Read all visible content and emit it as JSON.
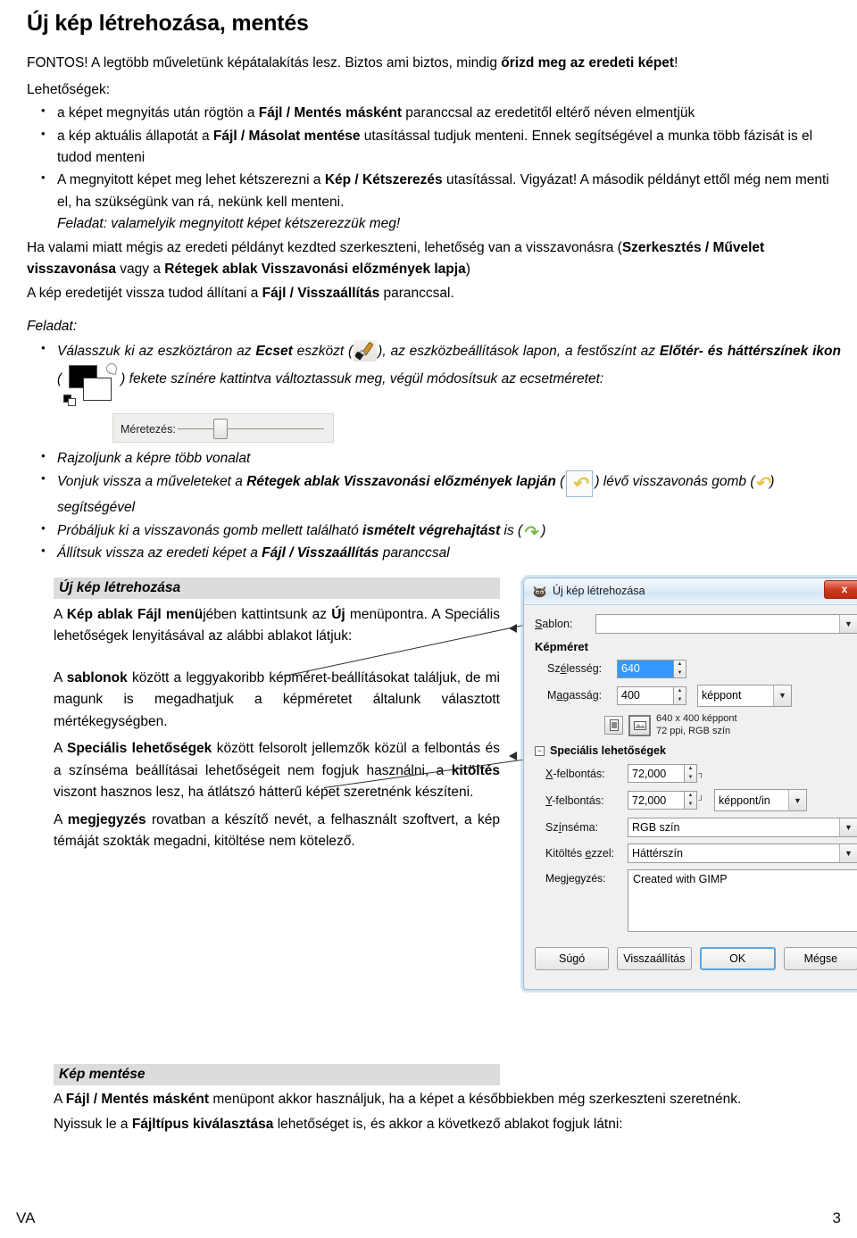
{
  "document": {
    "title": "Új kép létrehozása, mentés",
    "intro_prefix": "FONTOS! A legtöbb műveletünk képátalakítás lesz. Biztos ami biztos, mindig ",
    "intro_bold": "őrizd meg az eredeti képet",
    "intro_suffix": "!",
    "lehetosegek_label": "Lehetőségek:"
  },
  "options_bullets": [
    {
      "pre": "a képet megnyitás után rögtön a ",
      "bold": "Fájl / Mentés másként",
      "post": " paranccsal az eredetitől eltérő néven elmentjük"
    },
    {
      "pre": "a kép aktuális állapotát a ",
      "bold": "Fájl / Másolat mentése",
      "post": " utasítással tudjuk menteni. Ennek segítségével a munka több fázisát is el tudod menteni"
    },
    {
      "pre": "A megnyitott képet meg lehet kétszerezni a ",
      "bold": "Kép / Kétszerezés",
      "post": " utasítással. Vigyázat! A második példányt ettől még nem menti el, ha szükségünk van rá, nekünk kell menteni.",
      "task": "Feladat: valamelyik megnyitott képet kétszerezzük meg!"
    }
  ],
  "undo_paragraph": {
    "p1_pre": "Ha valami miatt mégis az eredeti példányt kezdted szerkeszteni, lehetőség van a visszavonásra (",
    "p1_bold1": "Szerkesztés / Művelet visszavonása",
    "p1_mid": " vagy a ",
    "p1_bold2": "Rétegek ablak Visszavonási előzmények lapja",
    "p1_post": ")",
    "p2_pre": "A kép eredetijét vissza tudod állítani a ",
    "p2_bold": "Fájl / Visszaállítás",
    "p2_post": " paranccsal."
  },
  "feladat_label": "Feladat:",
  "task_bullets": {
    "brush": {
      "pre": "Válasszuk ki az eszköztáron az ",
      "bold1": "Ecset",
      "mid1": " eszközt (",
      "icon1": "brush-icon",
      "mid2": "), az eszközbeállítások lapon, a festőszínt az ",
      "bold2": "Előtér- és háttérszínek ikon",
      "mid3": " (",
      "icon2": "foreground-background-color-icon",
      "post": ") fekete színére kattintva változtassuk meg, végül módosítsuk az ecsetméretet:"
    },
    "size_widget_label": "Méretezés:",
    "draw": "Rajzoljunk a képre több vonalat",
    "undo": {
      "pre": "Vonjuk vissza a műveleteket a ",
      "bold": "Rétegek ablak Visszavonási előzmények lapján",
      "mid1": " (",
      "icon1": "undo-history-tab-icon",
      "mid2": ") lévő visszavonás gomb (",
      "icon2": "undo-arrow-icon",
      "post": ") segítségével"
    },
    "redo": {
      "pre": "Próbáljuk ki a visszavonás gomb mellett található ",
      "bold": "ismételt végrehajtást",
      "mid": " is (",
      "icon": "redo-arrow-icon",
      "post": " )"
    },
    "revert": {
      "pre": "Állítsuk vissza az eredeti képet a ",
      "bold": "Fájl / Visszaállítás",
      "post": " paranccsal"
    }
  },
  "section_new_image": {
    "heading": "Új kép létrehozása",
    "p1_pre": "A ",
    "p1_bold": "Kép ablak Fájl menü",
    "p1_post": "jében kattintsunk az ",
    "p1_bold2": "Új",
    "p1_post2": " menüpontra. A Speciális lehetőségek lenyitásával az alábbi ablakot látjuk:",
    "p2_pre": "A ",
    "p2_bold": "sablonok",
    "p2_post": " között a leggyakoribb képméret-beállításokat találjuk, de mi magunk is megadhatjuk a képméretet általunk választott mértékegységben.",
    "p3_pre": "A ",
    "p3_bold": "Speciális lehetőségek",
    "p3_mid": " között felsorolt jellemzők közül a felbontás és a színséma beállításai lehetőségeit nem fogjuk használni, a ",
    "p3_bold2": "kitöltés",
    "p3_post": " viszont hasznos lesz, ha átlátszó hátterű képet szeretnénk készíteni.",
    "p4_pre": "A ",
    "p4_bold": "megjegyzés",
    "p4_post": " rovatban a készítő nevét, a felhasznált szoftvert, a kép témáját szokták megadni, kitöltése nem kötelező."
  },
  "dialog": {
    "title": "Új kép létrehozása",
    "close_label": "x",
    "sablon_label": "Sablon:",
    "sablon_value": "",
    "kepmeret_label": "Képméret",
    "szelesseg_label": "Szélesség:",
    "szelesseg_value": "640",
    "magassag_label": "Magasság:",
    "magassag_value": "400",
    "unit_value": "képpont",
    "preview_line1": "640 x 400 képpont",
    "preview_line2": "72 ppi, RGB szín",
    "spec_label": "Speciális lehetőségek",
    "expander_glyph": "−",
    "xfelbontas_label": "X-felbontás:",
    "xfelbontas_value": "72,000",
    "yfelbontas_label": "Y-felbontás:",
    "yfelbontas_value": "72,000",
    "res_unit_value": "képpont/in",
    "szinsema_label": "Színséma:",
    "szinsema_value": "RGB szín",
    "kitoltes_label": "Kitöltés ezzel:",
    "kitoltes_value": "Háttérszín",
    "megjegyzes_label": "Megjegyzés:",
    "megjegyzes_value": "Created with GIMP",
    "btn_sugo": "Súgó",
    "btn_visszaallitas": "Visszaállítás",
    "btn_ok": "OK",
    "btn_megse": "Mégse"
  },
  "section_save": {
    "heading": "Kép mentése",
    "p1_pre": "A ",
    "p1_bold": "Fájl / Mentés másként",
    "p1_post": " menüpont akkor használjuk, ha a képet a későbbiekben még szerkeszteni szeretnénk.",
    "p2_pre": "Nyissuk le a ",
    "p2_bold": "Fájltípus kiválasztása",
    "p2_post": " lehetőséget is, és akkor a következő ablakot fogjuk látni:"
  },
  "footer": {
    "left": "VA",
    "right": "3"
  },
  "colors": {
    "band_bg": "#dcdcdc",
    "dialog_bg": "#f0f0f0",
    "titlebar": "#dbeaf6",
    "close_red": "#cf3b22",
    "undo_yellow": "#e8c63a",
    "redo_green": "#6fbf3a",
    "selection_blue": "#3399ff"
  }
}
